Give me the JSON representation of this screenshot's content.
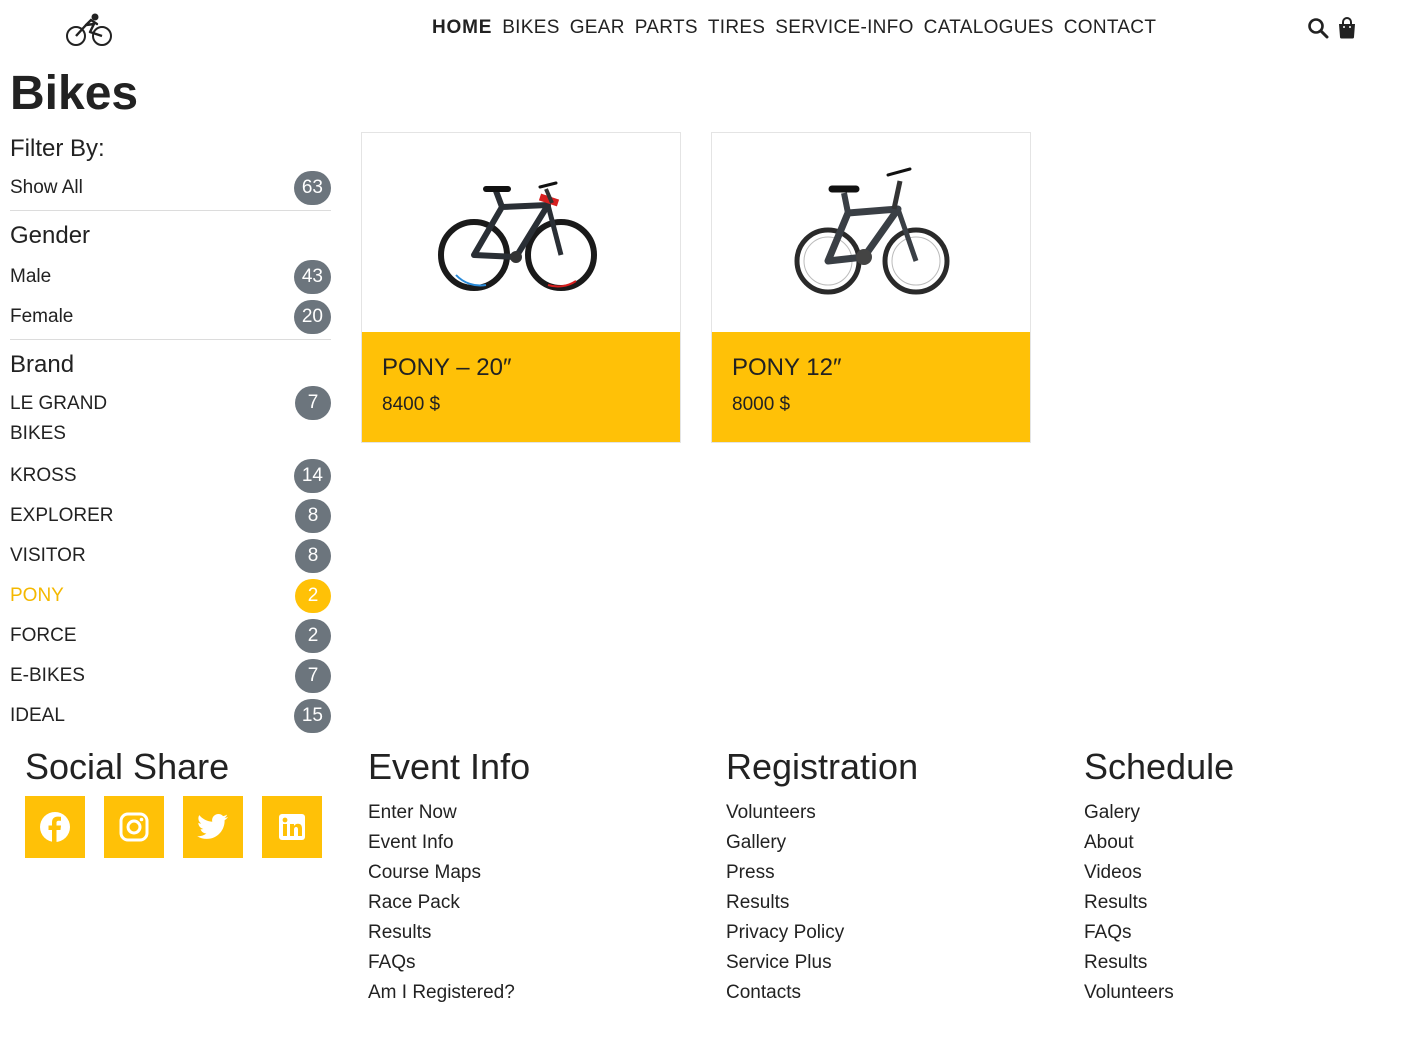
{
  "nav": {
    "items": [
      "HOME",
      "BIKES",
      "GEAR",
      "PARTS",
      "TIRES",
      "SERVICE-INFO",
      "CATALOGUES",
      "CONTACT"
    ],
    "active": "HOME"
  },
  "header_icons": [
    "search-icon",
    "shopping-bag-icon"
  ],
  "page": {
    "title": "Bikes"
  },
  "filters": {
    "title": "Filter By:",
    "show_all": {
      "label": "Show All",
      "count": "63"
    },
    "gender": {
      "title": "Gender",
      "items": [
        {
          "label": "Male",
          "count": "43"
        },
        {
          "label": "Female",
          "count": "20"
        }
      ]
    },
    "brand": {
      "title": "Brand",
      "items": [
        {
          "label": "LE GRAND BIKES",
          "count": "7"
        },
        {
          "label": "KROSS",
          "count": "14"
        },
        {
          "label": "EXPLORER",
          "count": "8"
        },
        {
          "label": "VISITOR",
          "count": "8"
        },
        {
          "label": "PONY",
          "count": "2",
          "active": true
        },
        {
          "label": "FORCE",
          "count": "2"
        },
        {
          "label": "E-BIKES",
          "count": "7"
        },
        {
          "label": "IDEAL",
          "count": "15"
        }
      ]
    }
  },
  "products": [
    {
      "name": "PONY – 20″",
      "price": "8400 $"
    },
    {
      "name": "PONY 12″",
      "price": "8000 $"
    }
  ],
  "footer": {
    "social": {
      "title": "Social Share",
      "icons": [
        "facebook-icon",
        "instagram-icon",
        "twitter-icon",
        "linkedin-icon"
      ]
    },
    "event_info": {
      "title": "Event Info",
      "links": [
        "Enter Now",
        "Event Info",
        "Course Maps",
        "Race Pack",
        "Results",
        "FAQs",
        "Am I Registered?"
      ]
    },
    "registration": {
      "title": "Registration",
      "links": [
        "Volunteers",
        "Gallery",
        "Press",
        "Results",
        "Privacy Policy",
        "Service Plus",
        "Contacts"
      ]
    },
    "schedule": {
      "title": "Schedule",
      "links": [
        "Galery",
        "About",
        "Videos",
        "Results",
        "FAQs",
        "Results",
        "Volunteers"
      ]
    }
  },
  "colors": {
    "accent": "#ffc107",
    "badge": "#6c757d",
    "text": "#222222"
  }
}
